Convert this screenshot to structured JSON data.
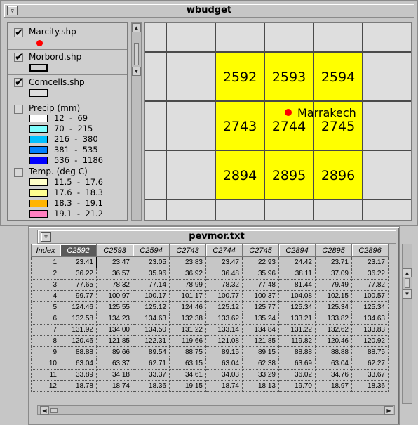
{
  "top_window": {
    "title": "wbudget",
    "menu_icon": "triangle-down-icon"
  },
  "legend": {
    "layers": [
      {
        "label": "Marcity.shp",
        "checked": true,
        "symbol": "red-dot"
      },
      {
        "label": "Morbord.shp",
        "checked": true,
        "symbol": "outline-rect"
      },
      {
        "label": "Comcells.shp",
        "checked": true,
        "symbol": "grey-rect"
      },
      {
        "label": "Precip  (mm)",
        "checked": false
      },
      {
        "label": "Temp.  (deg  C)",
        "checked": false
      }
    ],
    "precip_classes": [
      {
        "label": "12  -  69",
        "color": "#ffffff"
      },
      {
        "label": "70  -  215",
        "color": "#80ffff"
      },
      {
        "label": "216  -  380",
        "color": "#00c0ff"
      },
      {
        "label": "381  -  535",
        "color": "#0080ff"
      },
      {
        "label": "536  -  1186",
        "color": "#0000ff"
      }
    ],
    "temp_classes": [
      {
        "label": "11.5  -  17.6",
        "color": "#ffffc8"
      },
      {
        "label": "17.6  -  18.3",
        "color": "#ffff90"
      },
      {
        "label": "18.3  -  19.1",
        "color": "#ffb400"
      },
      {
        "label": "19.1  -  21.2",
        "color": "#ff80c0"
      }
    ]
  },
  "map": {
    "cells": [
      "2592",
      "2593",
      "2594",
      "2743",
      "2744",
      "2745",
      "2894",
      "2895",
      "2896"
    ],
    "city": "Marrakech",
    "highlight_color": "#ffff00",
    "city_color": "#ff0000"
  },
  "table_window": {
    "title": "pevmor.txt",
    "menu_icon": "triangle-down-icon",
    "headers": [
      "Index",
      "C2592",
      "C2593",
      "C2594",
      "C2743",
      "C2744",
      "C2745",
      "C2894",
      "C2895",
      "C2896"
    ],
    "rows": [
      [
        "1",
        "23.41",
        "23.47",
        "23.05",
        "23.83",
        "23.47",
        "22.93",
        "24.42",
        "23.71",
        "23.17"
      ],
      [
        "2",
        "36.22",
        "36.57",
        "35.96",
        "36.92",
        "36.48",
        "35.96",
        "38.11",
        "37.09",
        "36.22"
      ],
      [
        "3",
        "77.65",
        "78.32",
        "77.14",
        "78.99",
        "78.32",
        "77.48",
        "81.44",
        "79.49",
        "77.82"
      ],
      [
        "4",
        "99.77",
        "100.97",
        "100.17",
        "101.17",
        "100.77",
        "100.37",
        "104.08",
        "102.15",
        "100.57"
      ],
      [
        "5",
        "124.46",
        "125.55",
        "125.12",
        "124.46",
        "125.12",
        "125.77",
        "125.34",
        "125.34",
        "125.34"
      ],
      [
        "6",
        "132.58",
        "134.23",
        "134.63",
        "132.38",
        "133.62",
        "135.24",
        "133.21",
        "133.82",
        "134.63"
      ],
      [
        "7",
        "131.92",
        "134.00",
        "134.50",
        "131.22",
        "133.14",
        "134.84",
        "131.22",
        "132.62",
        "133.83"
      ],
      [
        "8",
        "120.46",
        "121.85",
        "122.31",
        "119.66",
        "121.08",
        "121.85",
        "119.82",
        "120.46",
        "120.92"
      ],
      [
        "9",
        "88.88",
        "89.66",
        "89.54",
        "88.75",
        "89.15",
        "89.15",
        "88.88",
        "88.88",
        "88.75"
      ],
      [
        "10",
        "63.04",
        "63.37",
        "62.71",
        "63.15",
        "63.04",
        "62.38",
        "63.69",
        "63.04",
        "62.27"
      ],
      [
        "11",
        "33.89",
        "34.18",
        "33.37",
        "34.61",
        "34.03",
        "33.29",
        "36.02",
        "34.76",
        "33.67"
      ],
      [
        "12",
        "18.78",
        "18.74",
        "18.36",
        "19.15",
        "18.74",
        "18.13",
        "19.70",
        "18.97",
        "18.36"
      ]
    ]
  }
}
